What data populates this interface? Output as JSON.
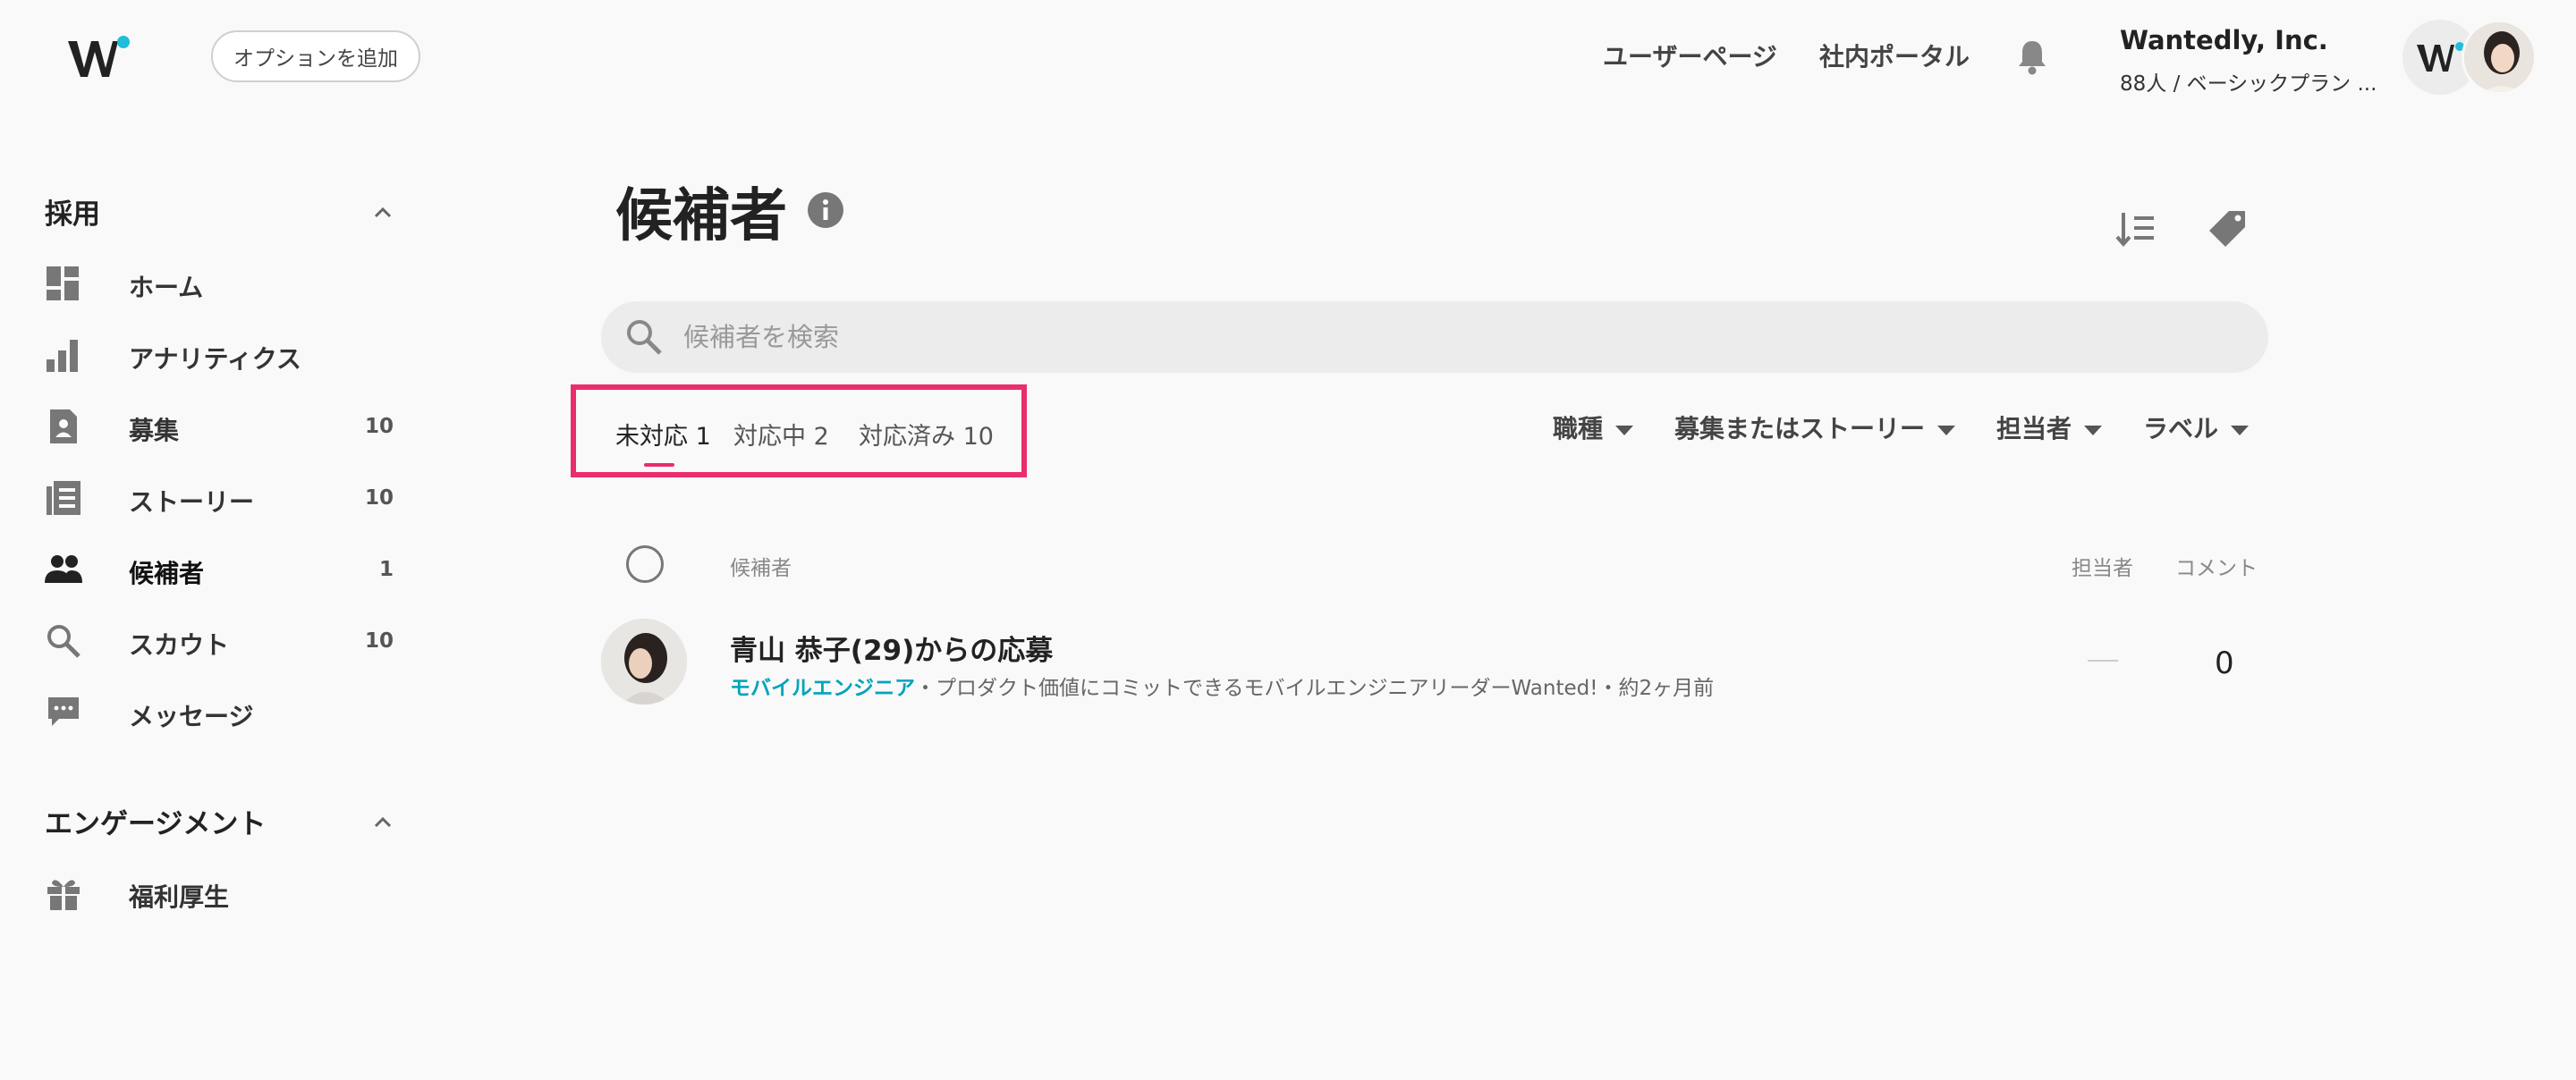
{
  "header": {
    "add_option": "オプションを追加",
    "links": [
      "ユーザーページ",
      "社内ポータル"
    ],
    "company_name": "Wantedly, Inc.",
    "company_sub": "88人 / ベーシックプラン ..."
  },
  "sidebar": {
    "section_recruit": "採用",
    "items": [
      {
        "label": "ホーム",
        "count": "",
        "icon": "dashboard-icon"
      },
      {
        "label": "アナリティクス",
        "count": "",
        "icon": "bar-chart-icon"
      },
      {
        "label": "募集",
        "count": "10",
        "icon": "job-post-icon"
      },
      {
        "label": "ストーリー",
        "count": "10",
        "icon": "story-icon"
      },
      {
        "label": "候補者",
        "count": "1",
        "icon": "people-icon"
      },
      {
        "label": "スカウト",
        "count": "10",
        "icon": "search-icon"
      },
      {
        "label": "メッセージ",
        "count": "",
        "icon": "chat-bubble-icon"
      }
    ],
    "section_engagement": "エンゲージメント",
    "engagement_items": [
      {
        "label": "福利厚生",
        "icon": "gift-icon"
      }
    ]
  },
  "main": {
    "title": "候補者",
    "search_placeholder": "候補者を検索",
    "tabs": [
      "未対応 1",
      "対応中 2",
      "対応済み 10"
    ],
    "filters": [
      "職種",
      "募集またはストーリー",
      "担当者",
      "ラベル"
    ],
    "columns": {
      "candidate": "候補者",
      "assignee": "担当者",
      "comment": "コメント"
    },
    "rows": [
      {
        "title": "青山 恭子(29)からの応募",
        "job": "モバイルエンジニア",
        "detail": "・プロダクト価値にコミットできるモバイルエンジニアリーダーWanted!・約2ヶ月前",
        "assignee": "—",
        "comments": "0"
      }
    ]
  },
  "colors": {
    "accent_pink": "#ea2d6b",
    "link_cyan": "#00a4bb",
    "logo_dot": "#21bddb"
  }
}
